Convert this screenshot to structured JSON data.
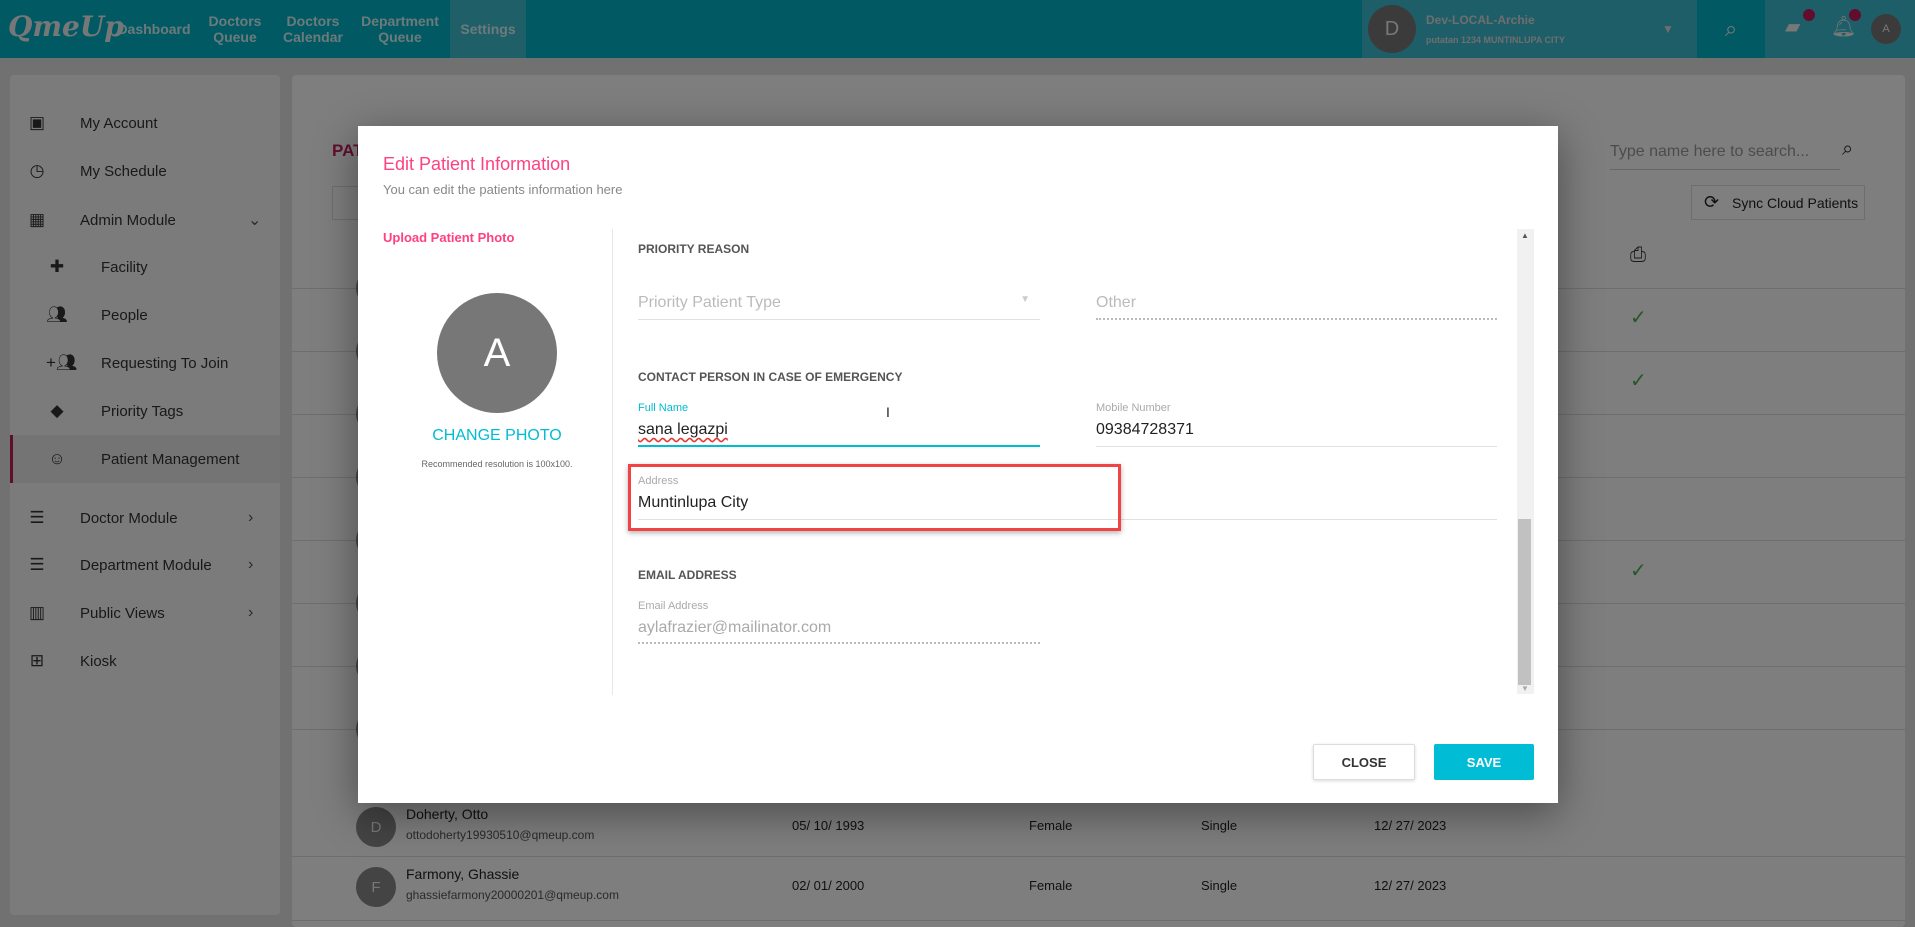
{
  "topbar": {
    "logo": "QmeUp",
    "nav": [
      "Dashboard",
      "Doctors Queue",
      "Doctors Calendar",
      "Department Queue",
      "Settings"
    ],
    "active": "Settings",
    "account": {
      "initial": "D",
      "name": "Dev-LOCAL-Archie",
      "location": "putatan 1234 MUNTINLUPA CITY"
    },
    "user_initial": "A",
    "icons": [
      "search-icon",
      "chat-icon",
      "bell-icon"
    ]
  },
  "sidebar": {
    "items": [
      {
        "label": "My Account"
      },
      {
        "label": "My Schedule"
      },
      {
        "label": "Admin Module"
      },
      {
        "label": "Facility"
      },
      {
        "label": "People"
      },
      {
        "label": "Requesting To Join"
      },
      {
        "label": "Priority Tags"
      },
      {
        "label": "Patient Management"
      },
      {
        "label": "Doctor Module"
      },
      {
        "label": "Department Module"
      },
      {
        "label": "Public Views"
      },
      {
        "label": "Kiosk"
      }
    ],
    "active": "Patient Management"
  },
  "main": {
    "title_partial": "PAT",
    "search_placeholder": "Type name here to search...",
    "sync_label": "Sync Cloud Patients",
    "rows": [
      {
        "initial": "D",
        "name": "Doherty, Otto",
        "email": "ottodoherty19930510@qmeup.com",
        "birthdate": "05/ 10/ 1993",
        "gender": "Female",
        "status": "Single",
        "date": "12/ 27/ 2023"
      },
      {
        "initial": "F",
        "name": "Farmony, Ghassie",
        "email": "ghassiefarmony20000201@qmeup.com",
        "birthdate": "02/ 01/ 2000",
        "gender": "Female",
        "status": "Single",
        "date": "12/ 27/ 2023"
      }
    ]
  },
  "modal": {
    "title": "Edit Patient Information",
    "subtitle": "You can edit the patients information here",
    "upload_label": "Upload Patient Photo",
    "avatar_initial": "A",
    "change_photo": "CHANGE PHOTO",
    "photo_hint": "Recommended resolution is 100x100.",
    "priority_section": "PRIORITY REASON",
    "priority_type_placeholder": "Priority Patient Type",
    "other_placeholder": "Other",
    "contact_section": "CONTACT PERSON IN CASE OF EMERGENCY",
    "full_name_label": "Full Name",
    "full_name": "sana legazpi",
    "mobile_label": "Mobile Number",
    "mobile": "09384728371",
    "address_label": "Address",
    "address": "Muntinlupa City",
    "email_section": "EMAIL ADDRESS",
    "email_label": "Email Address",
    "email": "aylafrazier@mailinator.com",
    "close": "CLOSE",
    "save": "SAVE"
  },
  "colors": {
    "accent_pink": "#ff4081",
    "accent_teal": "#00bcd4",
    "highlight": "#f04444"
  }
}
